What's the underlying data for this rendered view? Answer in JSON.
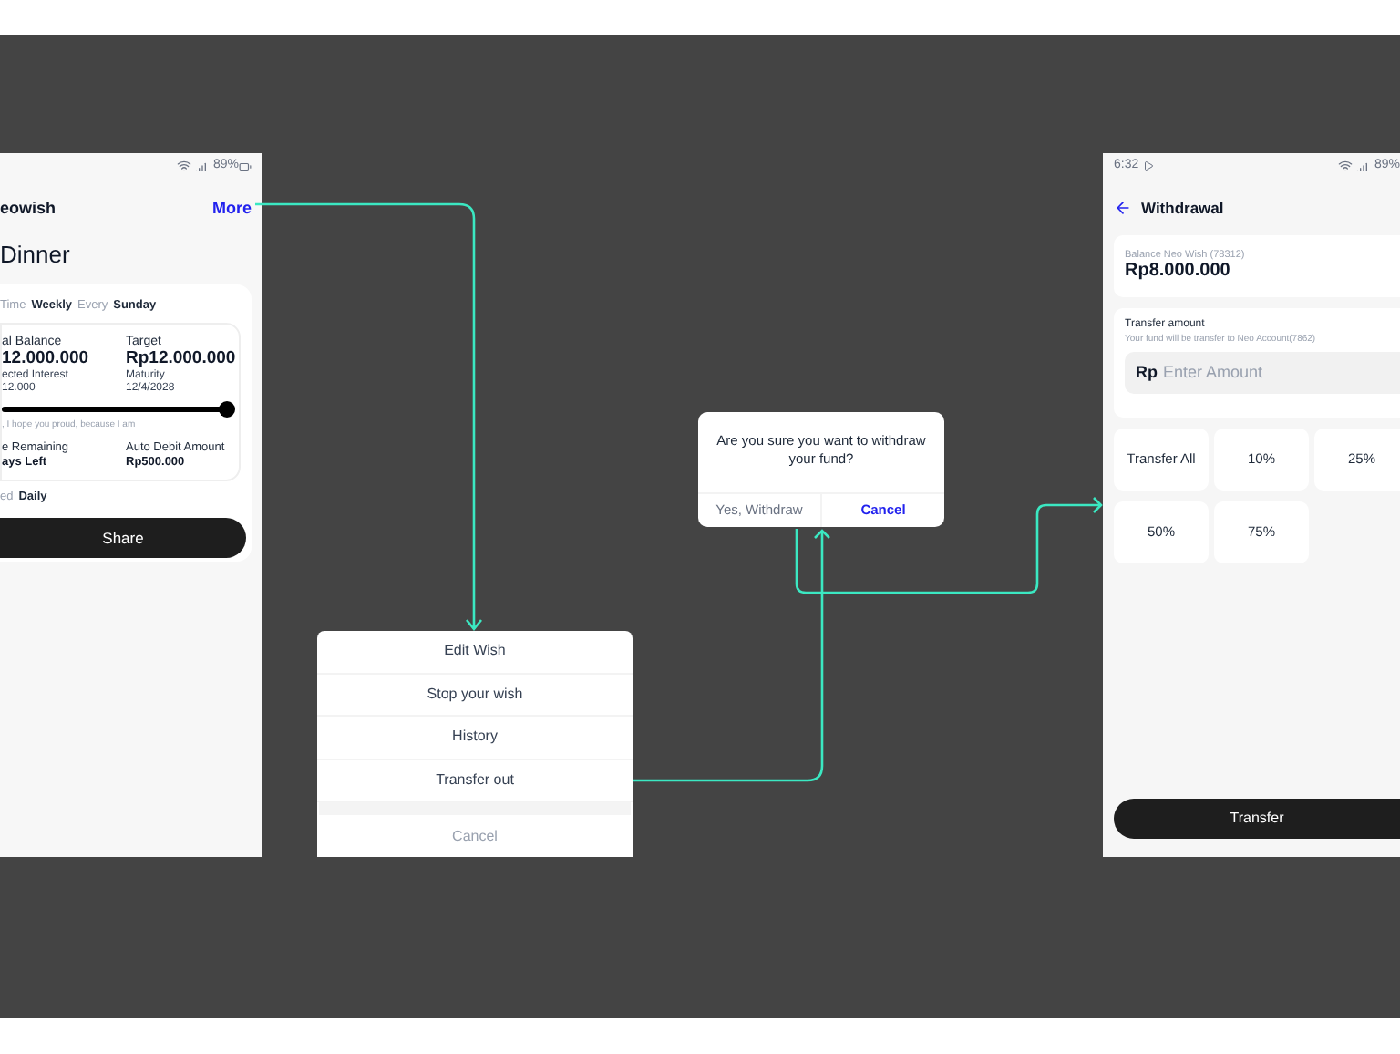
{
  "wish_screen": {
    "status": {
      "battery": "89%"
    },
    "header": {
      "title": "eowish",
      "action": "More"
    },
    "wish_title": "Dinner",
    "schedule": [
      {
        "label": "Time",
        "value": "Weekly"
      },
      {
        "label": "Every",
        "value": "Sunday"
      }
    ],
    "balance": {
      "label": "al Balance",
      "value": "12.000.000",
      "sub_label": "ected Interest",
      "sub_value": "12.000"
    },
    "target": {
      "label": "Target",
      "value": "Rp12.000.000",
      "sub_label": "Maturity",
      "sub_value": "12/4/2028"
    },
    "progress": {
      "level": 1,
      "caption": ", I hope you proud, because I am"
    },
    "remaining": {
      "label": "e Remaining",
      "value": "ays Left"
    },
    "auto_debit": {
      "label": "Auto Debit Amount",
      "value": "Rp500.000"
    },
    "frequency": {
      "label": "ed",
      "value": "Daily"
    },
    "share_button": "Share"
  },
  "action_sheet": {
    "items": [
      {
        "label": "Edit Wish",
        "kind": "option"
      },
      {
        "label": "Stop your wish",
        "kind": "option"
      },
      {
        "label": "History",
        "kind": "option"
      },
      {
        "label": "Transfer out",
        "kind": "option"
      },
      {
        "label": "Cancel",
        "kind": "cancel"
      }
    ]
  },
  "confirm_dialog": {
    "message": "Are you sure you want to withdraw your fund?",
    "buttons": [
      {
        "label": "Yes, Withdraw",
        "kind": "secondary"
      },
      {
        "label": "Cancel",
        "kind": "primary"
      }
    ]
  },
  "withdrawal_screen": {
    "status": {
      "time": "6:32",
      "battery": "89%"
    },
    "title": "Withdrawal",
    "balance": {
      "label": "Balance Neo Wish (78312)",
      "value": "Rp8.000.000"
    },
    "transfer": {
      "label": "Transfer amount",
      "hint": "Your fund will be transfer to Neo Account(7862)",
      "prefix": "Rp",
      "placeholder": "Enter Amount"
    },
    "quick_amounts": [
      "Transfer All",
      "10%",
      "25%",
      "50%",
      "75%"
    ],
    "submit_button": "Transfer"
  }
}
